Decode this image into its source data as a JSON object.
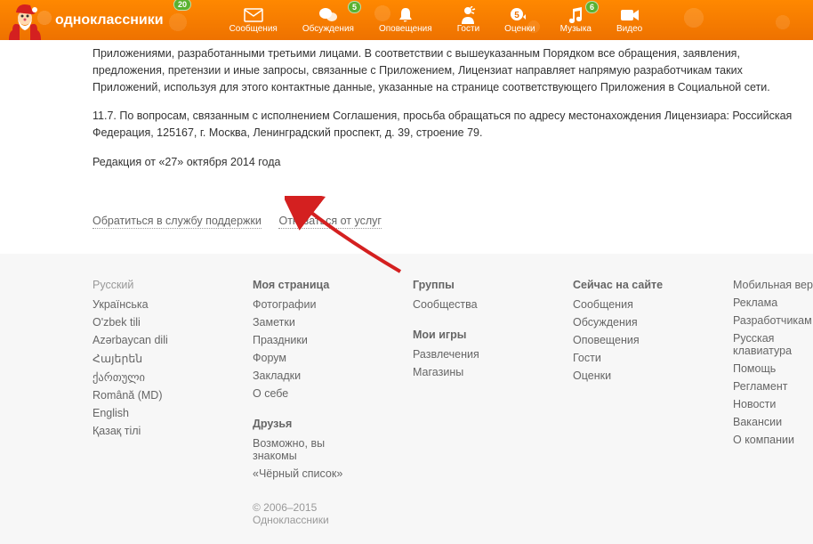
{
  "header": {
    "logo_text": "одноклассники",
    "logo_badge": "20",
    "nav": [
      {
        "label": "Сообщения",
        "icon": "envelope",
        "badge": null
      },
      {
        "label": "Обсуждения",
        "icon": "chat",
        "badge": "5"
      },
      {
        "label": "Оповещения",
        "icon": "bell",
        "badge": null
      },
      {
        "label": "Гости",
        "icon": "person",
        "badge": null
      },
      {
        "label": "Оценки",
        "icon": "rating",
        "badge": null
      },
      {
        "label": "Музыка",
        "icon": "note",
        "badge": "6"
      },
      {
        "label": "Видео",
        "icon": "camera",
        "badge": null
      }
    ]
  },
  "content": {
    "p1": "Приложениями, разработанными третьими лицами. В соответствии с вышеуказанным Порядком все обращения, заявления, предложения, претензии и иные запросы, связанные с Приложением, Лицензиат направляет напрямую разработчикам таких Приложений, используя для этого контактные данные, указанные на странице соответствующего Приложения в Социальной сети.",
    "p2": "11.7. По вопросам, связанным с исполнением Соглашения, просьба обращаться по адресу местонахождения Лицензиара: Российская Федерация, 125167, г. Москва, Ленинградский проспект, д. 39, строение 79.",
    "p3": "Редакция от «27» октября 2014 года"
  },
  "action_links": {
    "support": "Обратиться в службу поддержки",
    "optout": "Отказаться от услуг"
  },
  "footer": {
    "languages": {
      "heading": "Русский",
      "items": [
        "Українська",
        "O'zbek tili",
        "Azərbaycan dili",
        "Հայերեն",
        "ქართული",
        "Română (MD)",
        "English",
        "Қазақ тілі"
      ]
    },
    "mypage": {
      "heading": "Моя страница",
      "items": [
        "Фотографии",
        "Заметки",
        "Праздники",
        "Форум",
        "Закладки",
        "О себе"
      ]
    },
    "friends": {
      "heading": "Друзья",
      "items": [
        "Возможно, вы знакомы",
        "«Чёрный список»"
      ]
    },
    "groups": {
      "heading": "Группы",
      "items": [
        "Сообщества"
      ]
    },
    "games": {
      "heading": "Мои игры",
      "items": [
        "Развлечения",
        "Магазины"
      ]
    },
    "online": {
      "heading": "Сейчас на сайте",
      "items": [
        "Сообщения",
        "Обсуждения",
        "Оповещения",
        "Гости",
        "Оценки"
      ]
    },
    "misc": {
      "items": [
        "Мобильная версия",
        "Реклама",
        "Разработчикам",
        "Русская клавиатура",
        "Помощь",
        "Регламент",
        "Новости",
        "Вакансии",
        "О компании"
      ]
    },
    "copyright": "© 2006–2015 Одноклассники"
  }
}
